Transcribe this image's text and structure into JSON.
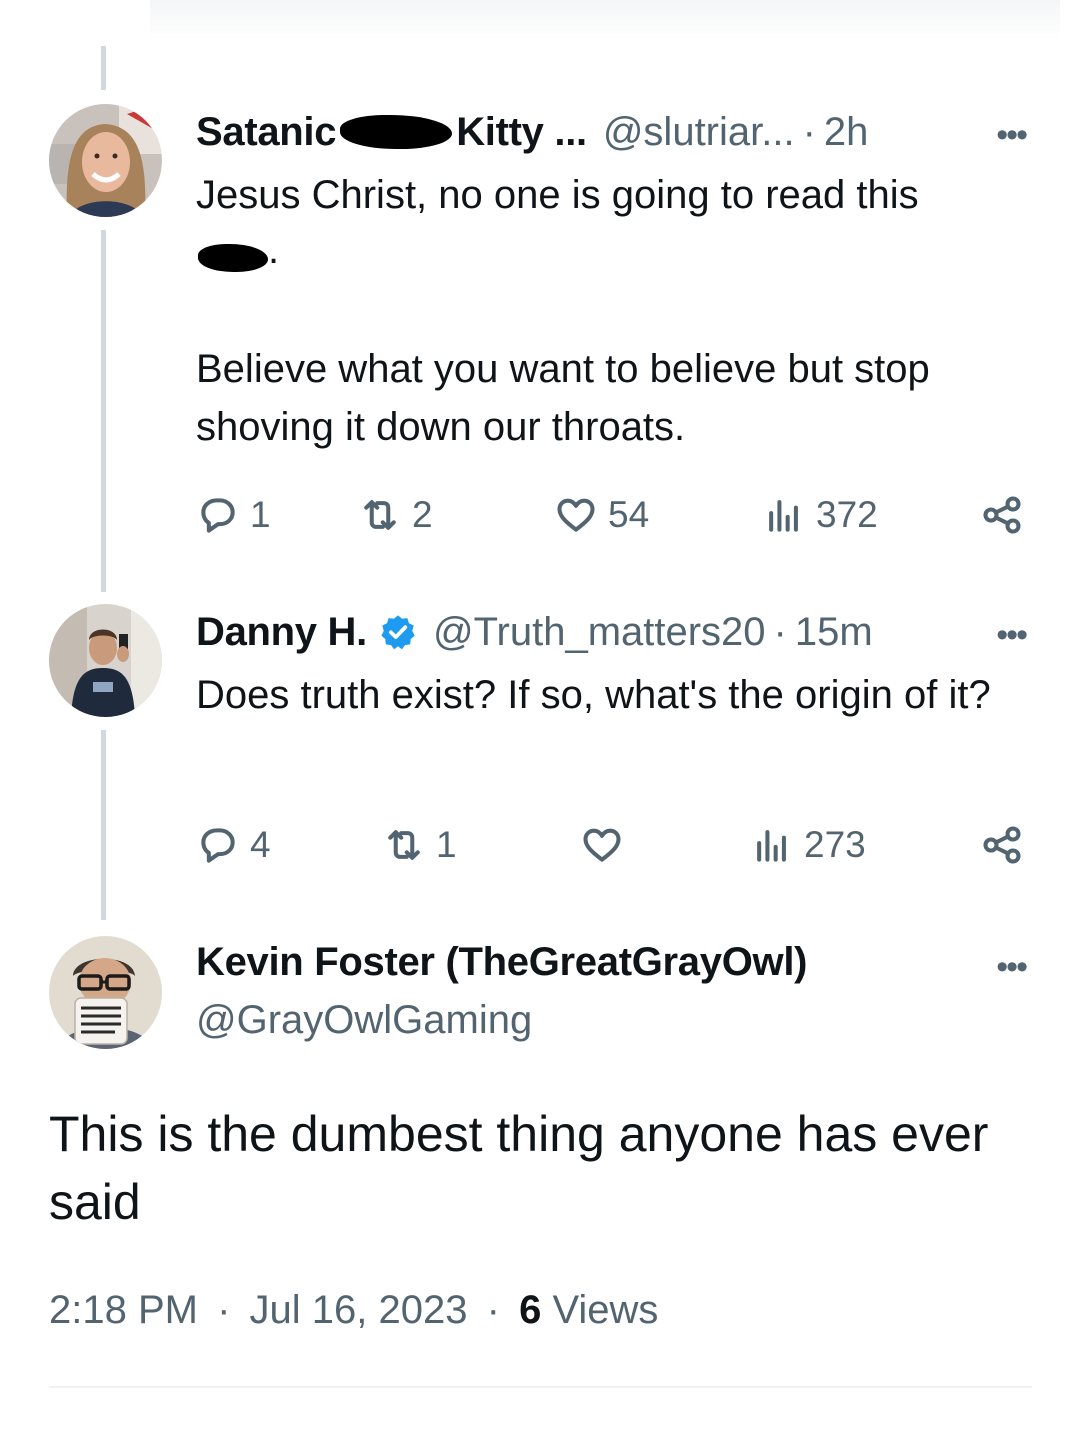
{
  "reply1": {
    "name_part1": "Satanic",
    "name_part2": "Kitty ...",
    "handle": "@slutriar...",
    "separator": "·",
    "time": "2h",
    "more": "•••",
    "text": "Jesus Christ, no one is going to read this\n\n\nBelieve what you want to believe but stop shoving it down our throats.",
    "censored_suffix": ".",
    "replies": "1",
    "retweets": "2",
    "likes": "54",
    "views": "372"
  },
  "reply2": {
    "name": "Danny H.",
    "verified": true,
    "handle": "@Truth_matters20",
    "separator": "·",
    "time": "15m",
    "more": "•••",
    "text": "Does truth exist? If so, what's the origin of it?",
    "replies": "4",
    "retweets": "1",
    "likes": "",
    "views": "273"
  },
  "main_tweet": {
    "name": "Kevin Foster (TheGreatGrayOwl)",
    "handle": "@GrayOwlGaming",
    "more": "•••",
    "text": "This is the dumbest thing anyone has ever said",
    "time": "2:18 PM",
    "separator": "·",
    "date": "Jul 16, 2023",
    "views_count": "6",
    "views_label": "Views"
  },
  "colors": {
    "text": "#0f1419",
    "secondary": "#536471",
    "thread_line": "#cfd9de",
    "verified": "#1d9bf0"
  },
  "icons": [
    "reply-icon",
    "retweet-icon",
    "like-icon",
    "views-icon",
    "share-icon",
    "verified-badge-icon",
    "more-icon"
  ]
}
